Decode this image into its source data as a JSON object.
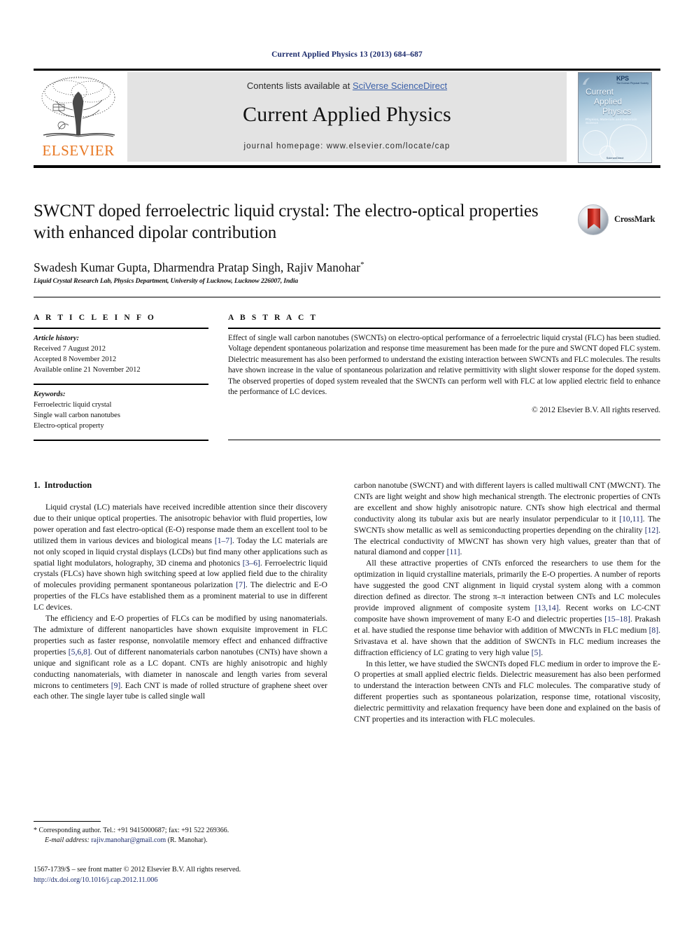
{
  "running_head": "Current Applied Physics 13 (2013) 684–687",
  "masthead": {
    "publisher_logo_label": "ELSEVIER",
    "contents_prefix": "Contents lists available at ",
    "contents_link": "SciVerse ScienceDirect",
    "journal_name": "Current Applied Physics",
    "homepage_line": "journal homepage: www.elsevier.com/locate/cap",
    "cover": {
      "society_mark": "KPS",
      "society_sub": "The Korean Physical Society",
      "title_line1": "Current",
      "title_line2": "Applied",
      "title_line3": "Physics",
      "subtitle": "Physics, Materials and Materials Science",
      "footer": "ScienceDirect"
    }
  },
  "article": {
    "title": "SWCNT doped ferroelectric liquid crystal: The electro-optical properties with enhanced dipolar contribution",
    "authors": "Swadesh Kumar Gupta, Dharmendra Pratap Singh, Rajiv Manohar",
    "author_marker": "*",
    "affiliation": "Liquid Crystal Research Lab, Physics Department, University of Lucknow, Lucknow 226007, India",
    "crossmark_label": "CrossMark"
  },
  "article_info": {
    "heading": "A R T I C L E   I N F O",
    "history_label": "Article history:",
    "history": [
      "Received 7 August 2012",
      "Accepted 8 November 2012",
      "Available online 21 November 2012"
    ],
    "keywords_label": "Keywords:",
    "keywords": [
      "Ferroelectric liquid crystal",
      "Single wall carbon nanotubes",
      "Electro-optical property"
    ]
  },
  "abstract": {
    "heading": "A B S T R A C T",
    "text": "Effect of single wall carbon nanotubes (SWCNTs) on electro-optical performance of a ferroelectric liquid crystal (FLC) has been studied. Voltage dependent spontaneous polarization and response time measurement has been made for the pure and SWCNT doped FLC system. Dielectric measurement has also been performed to understand the existing interaction between SWCNTs and FLC molecules. The results have shown increase in the value of spontaneous polarization and relative permittivity with slight slower response for the doped system. The observed properties of doped system revealed that the SWCNTs can perform well with FLC at low applied electric field to enhance the performance of LC devices.",
    "copyright": "© 2012 Elsevier B.V. All rights reserved."
  },
  "body": {
    "section1_number": "1.",
    "section1_title": "Introduction",
    "left_paragraphs": [
      "Liquid crystal (LC) materials have received incredible attention since their discovery due to their unique optical properties. The anisotropic behavior with fluid properties, low power operation and fast electro-optical (E-O) response made them an excellent tool to be utilized them in various devices and biological means [1–7]. Today the LC materials are not only scoped in liquid crystal displays (LCDs) but find many other applications such as spatial light modulators, holography, 3D cinema and photonics [3–6]. Ferroelectric liquid crystals (FLCs) have shown high switching speed at low applied field due to the chirality of molecules providing permanent spontaneous polarization [7]. The dielectric and E-O properties of the FLCs have established them as a prominent material to use in different LC devices.",
      "The efficiency and E-O properties of FLCs can be modified by using nanomaterials. The admixture of different nanoparticles have shown exquisite improvement in FLC properties such as faster response, nonvolatile memory effect and enhanced diffractive properties [5,6,8]. Out of different nanomaterials carbon nanotubes (CNTs) have shown a unique and significant role as a LC dopant. CNTs are highly anisotropic and highly conducting nanomaterials, with diameter in nanoscale and length varies from several microns to centimeters [9]. Each CNT is made of rolled structure of graphene sheet over each other. The single layer tube is called single wall"
    ],
    "right_paragraphs": [
      "carbon nanotube (SWCNT) and with different layers is called multiwall CNT (MWCNT). The CNTs are light weight and show high mechanical strength. The electronic properties of CNTs are excellent and show highly anisotropic nature. CNTs show high electrical and thermal conductivity along its tubular axis but are nearly insulator perpendicular to it [10,11]. The SWCNTs show metallic as well as semiconducting properties depending on the chirality [12]. The electrical conductivity of MWCNT has shown very high values, greater than that of natural diamond and copper [11].",
      "All these attractive properties of CNTs enforced the researchers to use them for the optimization in liquid crystalline materials, primarily the E-O properties. A number of reports have suggested the good CNT alignment in liquid crystal system along with a common direction defined as director. The strong π–π interaction between CNTs and LC molecules provide improved alignment of composite system [13,14]. Recent works on LC-CNT composite have shown improvement of many E-O and dielectric properties [15–18]. Prakash et al. have studied the response time behavior with addition of MWCNTs in FLC medium [8]. Srivastava et al. have shown that the addition of SWCNTs in FLC medium increases the diffraction efficiency of LC grating to very high value [5].",
      "In this letter, we have studied the SWCNTs doped FLC medium in order to improve the E-O properties at small applied electric fields. Dielectric measurement has also been performed to understand the interaction between CNTs and FLC molecules. The comparative study of different properties such as spontaneous polarization, response time, rotational viscosity, dielectric permittivity and relaxation frequency have been done and explained on the basis of CNT properties and its interaction with FLC molecules."
    ]
  },
  "footnote": {
    "corresponding": "* Corresponding author. Tel.: +91 9415000687; fax: +91 522 269366.",
    "email_label": "E-mail address:",
    "email": "rajiv.manohar@gmail.com",
    "email_owner": "(R. Manohar)."
  },
  "imprint": {
    "line1": "1567-1739/$ – see front matter © 2012 Elsevier B.V. All rights reserved.",
    "doi": "http://dx.doi.org/10.1016/j.cap.2012.11.006"
  },
  "colors": {
    "link": "#1b2a6b",
    "elsevier_orange": "#e87722",
    "band_grey": "#e3e3e3",
    "sciencedirect_blue": "#3a5fa8"
  }
}
